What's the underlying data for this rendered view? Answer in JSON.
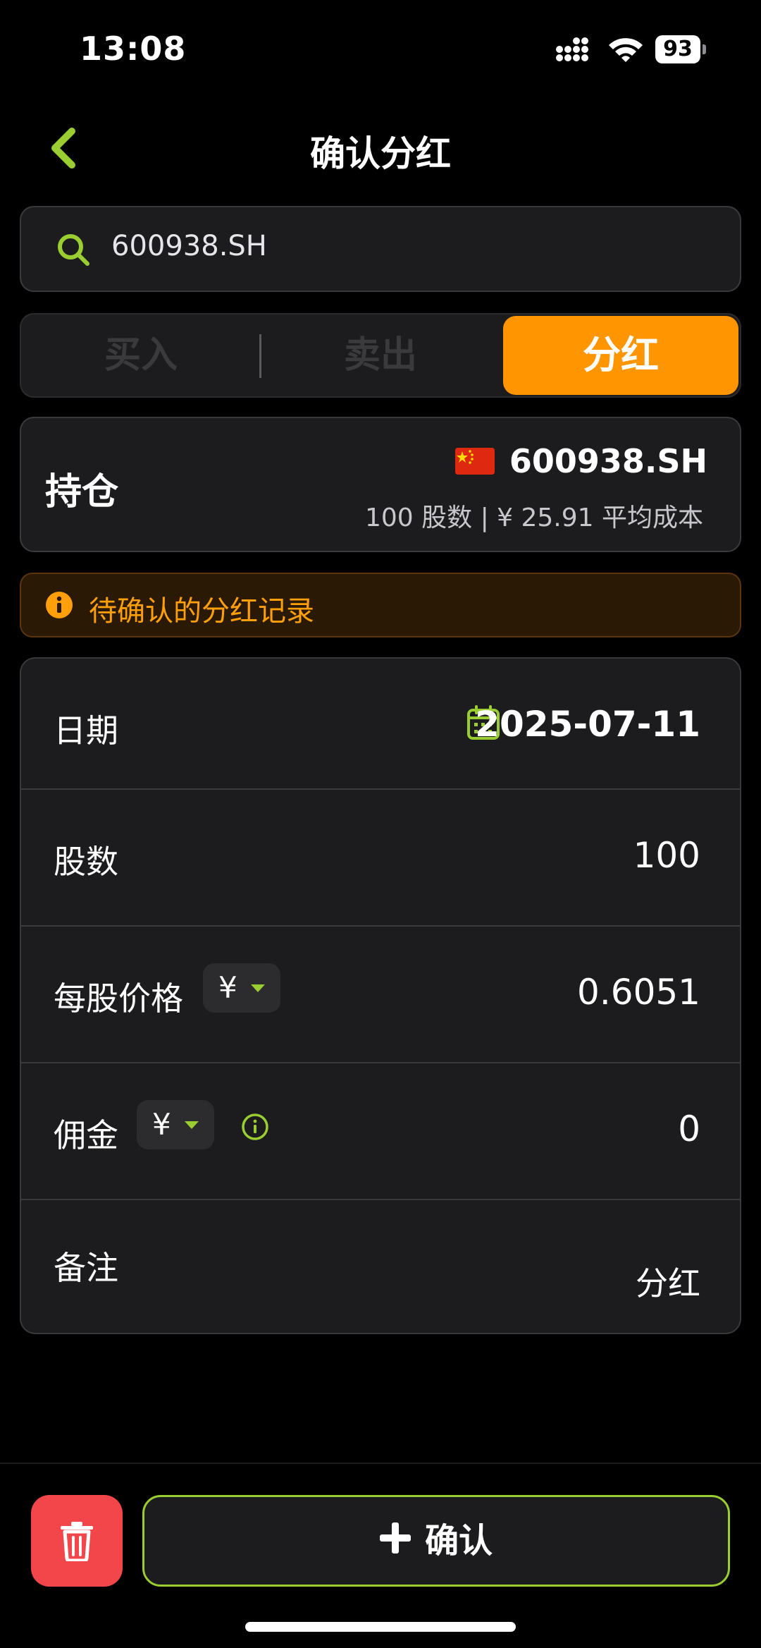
{
  "status_bar": {
    "time": "13:08",
    "battery": "93"
  },
  "header": {
    "title": "确认分红"
  },
  "search": {
    "value": "600938.SH"
  },
  "tabs": [
    {
      "label": "买入",
      "active": false
    },
    {
      "label": "卖出",
      "active": false
    },
    {
      "label": "分红",
      "active": true
    }
  ],
  "position": {
    "label": "持仓",
    "ticker": "600938.SH",
    "summary": "100 股数 | ¥ 25.91 平均成本"
  },
  "notice": {
    "text": "待确认的分红记录"
  },
  "form": {
    "date": {
      "label": "日期",
      "value": "2025-07-11"
    },
    "shares": {
      "label": "股数",
      "value": "100"
    },
    "price": {
      "label": "每股价格",
      "currency": "¥",
      "value": "0.6051"
    },
    "commission": {
      "label": "佣金",
      "currency": "¥",
      "value": "0"
    },
    "note": {
      "label": "备注",
      "value": "分红"
    }
  },
  "actions": {
    "confirm_label": "确认"
  },
  "colors": {
    "accent": "#9acd32",
    "active_tab": "#ff9500",
    "delete": "#f2464a",
    "warning": "#ff9f0a"
  }
}
